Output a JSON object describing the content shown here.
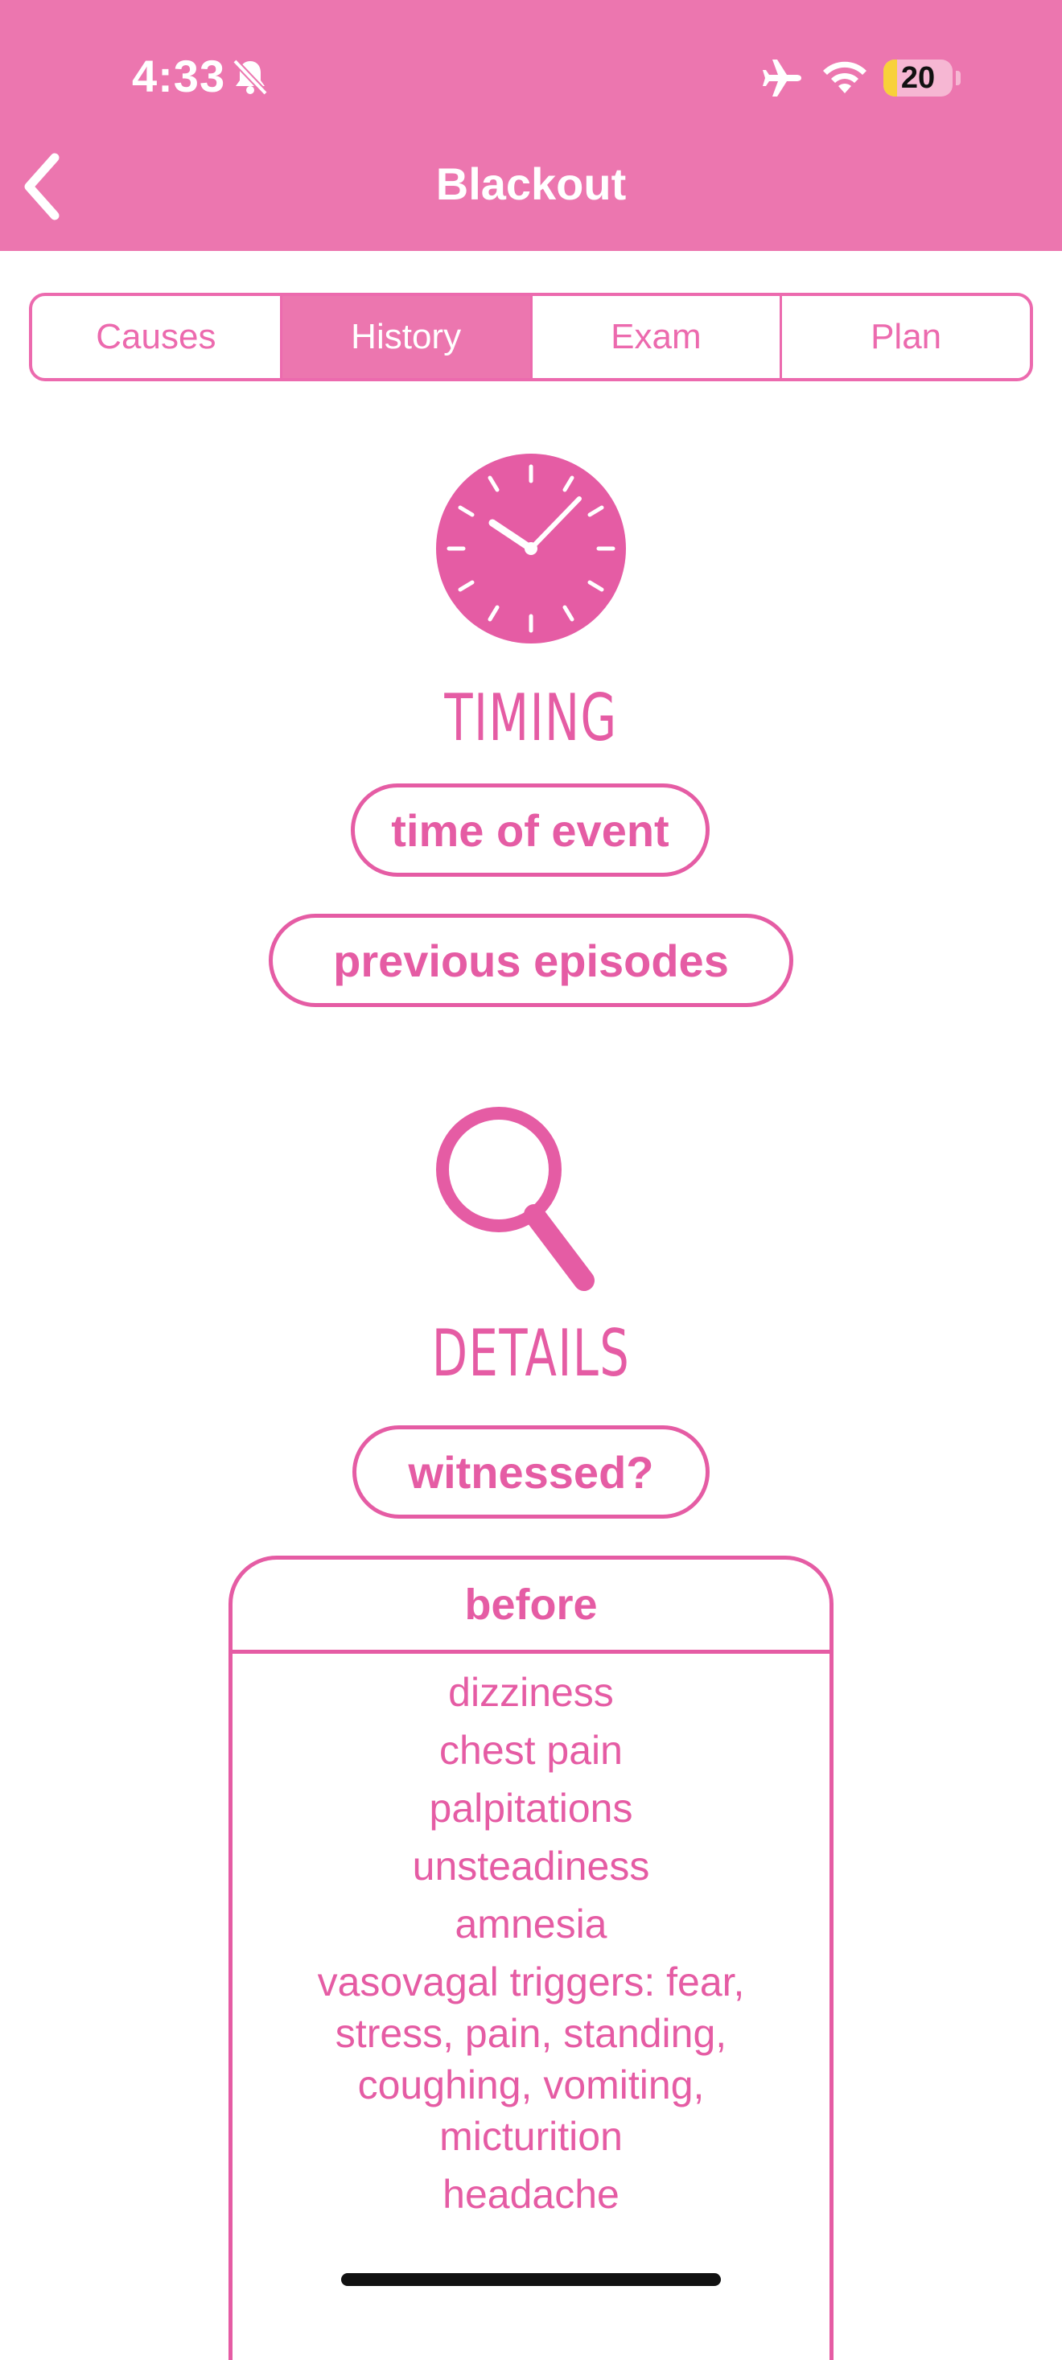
{
  "status_bar": {
    "time": "4:33",
    "battery": "20",
    "battery_level_percent": 20,
    "icons": [
      "bell-slash-icon",
      "airplane-icon",
      "wifi-icon",
      "battery-icon"
    ]
  },
  "nav": {
    "title": "Blackout",
    "back_icon": "chevron-left-icon"
  },
  "tabs": [
    {
      "label": "Causes",
      "active": false
    },
    {
      "label": "History",
      "active": true
    },
    {
      "label": "Exam",
      "active": false
    },
    {
      "label": "Plan",
      "active": false
    }
  ],
  "timing": {
    "icon": "clock-icon",
    "heading": "TIMING",
    "buttons": [
      "time of event",
      "previous episodes"
    ]
  },
  "details": {
    "icon": "magnifier-icon",
    "heading": "DETAILS",
    "button": "witnessed?",
    "card": {
      "title": "before",
      "items": [
        "dizziness",
        "chest pain",
        "palpitations",
        "unsteadiness",
        "amnesia",
        "vasovagal triggers: fear, stress, pain, standing, coughing, vomiting, micturition",
        "headache"
      ]
    }
  },
  "colors": {
    "header": "#EC76AF",
    "accent": "#E55CA4",
    "background": "#FFFFFF"
  }
}
